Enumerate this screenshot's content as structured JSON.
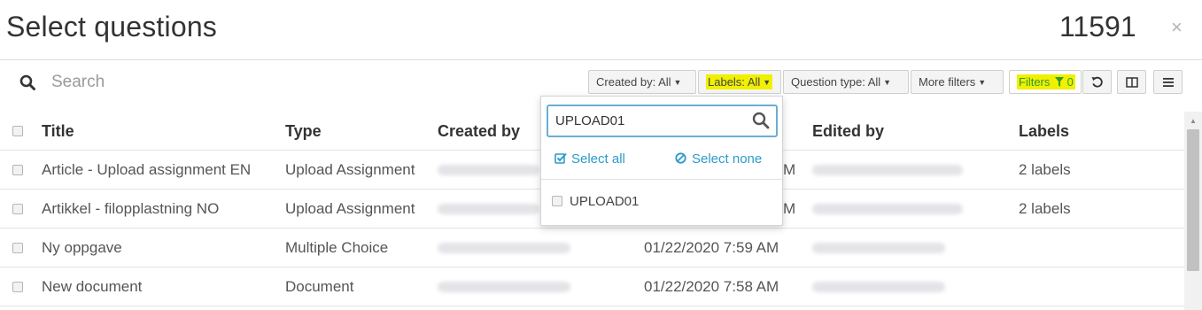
{
  "header": {
    "title": "Select questions",
    "count": "11591",
    "close_glyph": "×"
  },
  "search": {
    "placeholder": "Search"
  },
  "filters": {
    "created_by": "Created by: All",
    "labels": "Labels: All",
    "question_type": "Question type: All",
    "more_filters": "More filters",
    "filters_label": "Filters",
    "filters_count": "0",
    "highlight_color": "#f0f000",
    "filters_text_color": "#2f9a2f"
  },
  "table": {
    "columns": [
      "Title",
      "Type",
      "Created by",
      "",
      "Edited by",
      "Labels"
    ],
    "rows": [
      {
        "title": "Article - Upload assignment EN",
        "type": "Upload Assignment",
        "created": "",
        "edited": "M",
        "labels": "2 labels"
      },
      {
        "title": "Artikkel - filopplastning NO",
        "type": "Upload Assignment",
        "created": "",
        "edited": "M",
        "labels": "2 labels"
      },
      {
        "title": "Ny oppgave",
        "type": "Multiple Choice",
        "created": "",
        "edited": "01/22/2020 7:59 AM",
        "labels": ""
      },
      {
        "title": "New document",
        "type": "Document",
        "created": "",
        "edited": "01/22/2020 7:58 AM",
        "labels": ""
      }
    ]
  },
  "labels_dropdown": {
    "search_value": "UPLOAD01",
    "select_all": "Select all",
    "select_none": "Select none",
    "options": [
      "UPLOAD01"
    ],
    "link_color": "#2c9bc9"
  }
}
